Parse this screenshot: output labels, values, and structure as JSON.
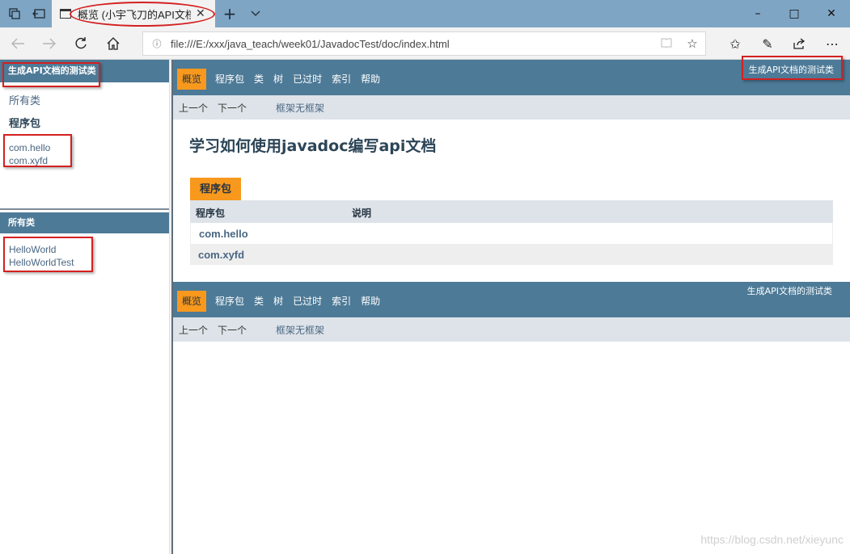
{
  "browser": {
    "tab_title": "概览 (小宇飞刀的API文档)",
    "address": "file:///E:/xxx/java_teach/week01/JavadocTest/doc/index.html",
    "window_controls": {
      "minimize": "–",
      "maximize": "□",
      "close": "✕"
    }
  },
  "left_top": {
    "header": "生成API文档的测试类",
    "all_classes_link": "所有类",
    "packages_heading": "程序包",
    "packages": [
      "com.hello",
      "com.xyfd"
    ]
  },
  "left_bottom": {
    "header": "所有类",
    "classes": [
      "HelloWorld",
      "HelloWorldTest"
    ]
  },
  "main": {
    "about_language": "生成API文档的测试类",
    "nav": [
      "概览",
      "程序包",
      "类",
      "树",
      "已过时",
      "索引",
      "帮助"
    ],
    "subnav": {
      "prev": "上一个",
      "next": "下一个",
      "frames": "框架",
      "no_frames": "无框架"
    },
    "doc_title": "学习如何使用javadoc编写api文档",
    "caption": "程序包",
    "table_headers": [
      "程序包",
      "说明"
    ],
    "rows": [
      "com.hello",
      "com.xyfd"
    ]
  },
  "watermark": "https://blog.csdn.net/xieyunc"
}
